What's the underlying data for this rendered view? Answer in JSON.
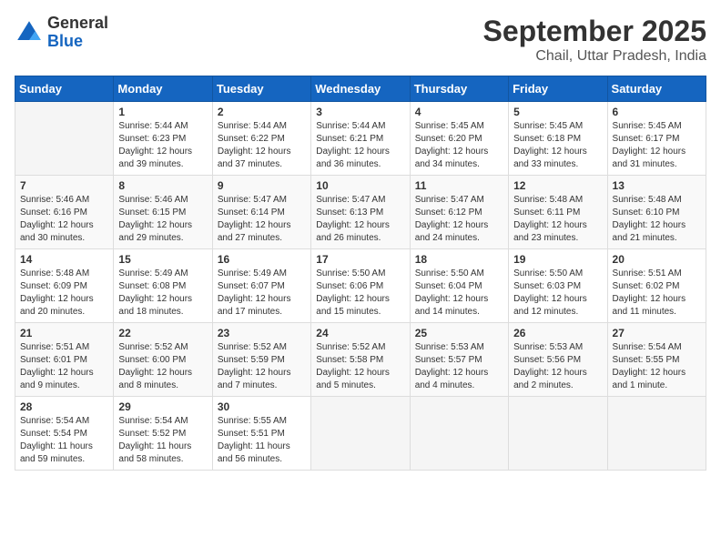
{
  "header": {
    "logo_line1": "General",
    "logo_line2": "Blue",
    "month": "September 2025",
    "location": "Chail, Uttar Pradesh, India"
  },
  "days_of_week": [
    "Sunday",
    "Monday",
    "Tuesday",
    "Wednesday",
    "Thursday",
    "Friday",
    "Saturday"
  ],
  "weeks": [
    [
      {
        "day": "",
        "info": ""
      },
      {
        "day": "1",
        "info": "Sunrise: 5:44 AM\nSunset: 6:23 PM\nDaylight: 12 hours\nand 39 minutes."
      },
      {
        "day": "2",
        "info": "Sunrise: 5:44 AM\nSunset: 6:22 PM\nDaylight: 12 hours\nand 37 minutes."
      },
      {
        "day": "3",
        "info": "Sunrise: 5:44 AM\nSunset: 6:21 PM\nDaylight: 12 hours\nand 36 minutes."
      },
      {
        "day": "4",
        "info": "Sunrise: 5:45 AM\nSunset: 6:20 PM\nDaylight: 12 hours\nand 34 minutes."
      },
      {
        "day": "5",
        "info": "Sunrise: 5:45 AM\nSunset: 6:18 PM\nDaylight: 12 hours\nand 33 minutes."
      },
      {
        "day": "6",
        "info": "Sunrise: 5:45 AM\nSunset: 6:17 PM\nDaylight: 12 hours\nand 31 minutes."
      }
    ],
    [
      {
        "day": "7",
        "info": "Sunrise: 5:46 AM\nSunset: 6:16 PM\nDaylight: 12 hours\nand 30 minutes."
      },
      {
        "day": "8",
        "info": "Sunrise: 5:46 AM\nSunset: 6:15 PM\nDaylight: 12 hours\nand 29 minutes."
      },
      {
        "day": "9",
        "info": "Sunrise: 5:47 AM\nSunset: 6:14 PM\nDaylight: 12 hours\nand 27 minutes."
      },
      {
        "day": "10",
        "info": "Sunrise: 5:47 AM\nSunset: 6:13 PM\nDaylight: 12 hours\nand 26 minutes."
      },
      {
        "day": "11",
        "info": "Sunrise: 5:47 AM\nSunset: 6:12 PM\nDaylight: 12 hours\nand 24 minutes."
      },
      {
        "day": "12",
        "info": "Sunrise: 5:48 AM\nSunset: 6:11 PM\nDaylight: 12 hours\nand 23 minutes."
      },
      {
        "day": "13",
        "info": "Sunrise: 5:48 AM\nSunset: 6:10 PM\nDaylight: 12 hours\nand 21 minutes."
      }
    ],
    [
      {
        "day": "14",
        "info": "Sunrise: 5:48 AM\nSunset: 6:09 PM\nDaylight: 12 hours\nand 20 minutes."
      },
      {
        "day": "15",
        "info": "Sunrise: 5:49 AM\nSunset: 6:08 PM\nDaylight: 12 hours\nand 18 minutes."
      },
      {
        "day": "16",
        "info": "Sunrise: 5:49 AM\nSunset: 6:07 PM\nDaylight: 12 hours\nand 17 minutes."
      },
      {
        "day": "17",
        "info": "Sunrise: 5:50 AM\nSunset: 6:06 PM\nDaylight: 12 hours\nand 15 minutes."
      },
      {
        "day": "18",
        "info": "Sunrise: 5:50 AM\nSunset: 6:04 PM\nDaylight: 12 hours\nand 14 minutes."
      },
      {
        "day": "19",
        "info": "Sunrise: 5:50 AM\nSunset: 6:03 PM\nDaylight: 12 hours\nand 12 minutes."
      },
      {
        "day": "20",
        "info": "Sunrise: 5:51 AM\nSunset: 6:02 PM\nDaylight: 12 hours\nand 11 minutes."
      }
    ],
    [
      {
        "day": "21",
        "info": "Sunrise: 5:51 AM\nSunset: 6:01 PM\nDaylight: 12 hours\nand 9 minutes."
      },
      {
        "day": "22",
        "info": "Sunrise: 5:52 AM\nSunset: 6:00 PM\nDaylight: 12 hours\nand 8 minutes."
      },
      {
        "day": "23",
        "info": "Sunrise: 5:52 AM\nSunset: 5:59 PM\nDaylight: 12 hours\nand 7 minutes."
      },
      {
        "day": "24",
        "info": "Sunrise: 5:52 AM\nSunset: 5:58 PM\nDaylight: 12 hours\nand 5 minutes."
      },
      {
        "day": "25",
        "info": "Sunrise: 5:53 AM\nSunset: 5:57 PM\nDaylight: 12 hours\nand 4 minutes."
      },
      {
        "day": "26",
        "info": "Sunrise: 5:53 AM\nSunset: 5:56 PM\nDaylight: 12 hours\nand 2 minutes."
      },
      {
        "day": "27",
        "info": "Sunrise: 5:54 AM\nSunset: 5:55 PM\nDaylight: 12 hours\nand 1 minute."
      }
    ],
    [
      {
        "day": "28",
        "info": "Sunrise: 5:54 AM\nSunset: 5:54 PM\nDaylight: 11 hours\nand 59 minutes."
      },
      {
        "day": "29",
        "info": "Sunrise: 5:54 AM\nSunset: 5:52 PM\nDaylight: 11 hours\nand 58 minutes."
      },
      {
        "day": "30",
        "info": "Sunrise: 5:55 AM\nSunset: 5:51 PM\nDaylight: 11 hours\nand 56 minutes."
      },
      {
        "day": "",
        "info": ""
      },
      {
        "day": "",
        "info": ""
      },
      {
        "day": "",
        "info": ""
      },
      {
        "day": "",
        "info": ""
      }
    ]
  ]
}
